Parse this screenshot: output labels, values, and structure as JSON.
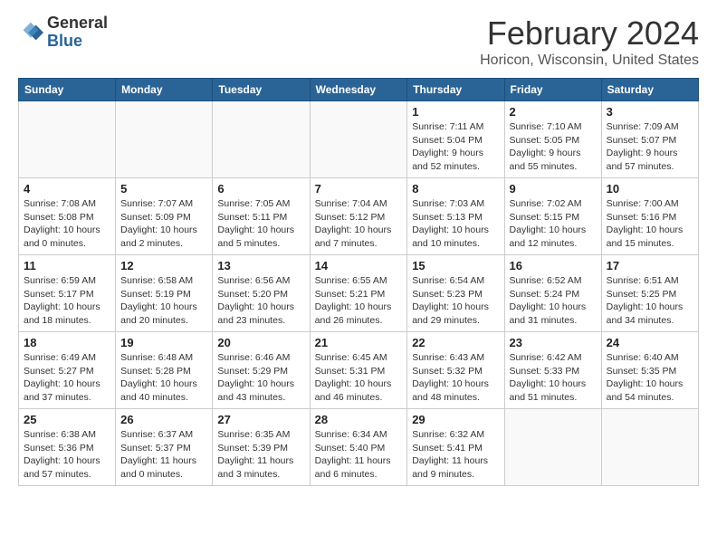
{
  "header": {
    "logo": {
      "general": "General",
      "blue": "Blue"
    },
    "title": "February 2024",
    "location": "Horicon, Wisconsin, United States"
  },
  "days_of_week": [
    "Sunday",
    "Monday",
    "Tuesday",
    "Wednesday",
    "Thursday",
    "Friday",
    "Saturday"
  ],
  "weeks": [
    [
      {
        "day": "",
        "info": ""
      },
      {
        "day": "",
        "info": ""
      },
      {
        "day": "",
        "info": ""
      },
      {
        "day": "",
        "info": ""
      },
      {
        "day": "1",
        "info": "Sunrise: 7:11 AM\nSunset: 5:04 PM\nDaylight: 9 hours\nand 52 minutes."
      },
      {
        "day": "2",
        "info": "Sunrise: 7:10 AM\nSunset: 5:05 PM\nDaylight: 9 hours\nand 55 minutes."
      },
      {
        "day": "3",
        "info": "Sunrise: 7:09 AM\nSunset: 5:07 PM\nDaylight: 9 hours\nand 57 minutes."
      }
    ],
    [
      {
        "day": "4",
        "info": "Sunrise: 7:08 AM\nSunset: 5:08 PM\nDaylight: 10 hours\nand 0 minutes."
      },
      {
        "day": "5",
        "info": "Sunrise: 7:07 AM\nSunset: 5:09 PM\nDaylight: 10 hours\nand 2 minutes."
      },
      {
        "day": "6",
        "info": "Sunrise: 7:05 AM\nSunset: 5:11 PM\nDaylight: 10 hours\nand 5 minutes."
      },
      {
        "day": "7",
        "info": "Sunrise: 7:04 AM\nSunset: 5:12 PM\nDaylight: 10 hours\nand 7 minutes."
      },
      {
        "day": "8",
        "info": "Sunrise: 7:03 AM\nSunset: 5:13 PM\nDaylight: 10 hours\nand 10 minutes."
      },
      {
        "day": "9",
        "info": "Sunrise: 7:02 AM\nSunset: 5:15 PM\nDaylight: 10 hours\nand 12 minutes."
      },
      {
        "day": "10",
        "info": "Sunrise: 7:00 AM\nSunset: 5:16 PM\nDaylight: 10 hours\nand 15 minutes."
      }
    ],
    [
      {
        "day": "11",
        "info": "Sunrise: 6:59 AM\nSunset: 5:17 PM\nDaylight: 10 hours\nand 18 minutes."
      },
      {
        "day": "12",
        "info": "Sunrise: 6:58 AM\nSunset: 5:19 PM\nDaylight: 10 hours\nand 20 minutes."
      },
      {
        "day": "13",
        "info": "Sunrise: 6:56 AM\nSunset: 5:20 PM\nDaylight: 10 hours\nand 23 minutes."
      },
      {
        "day": "14",
        "info": "Sunrise: 6:55 AM\nSunset: 5:21 PM\nDaylight: 10 hours\nand 26 minutes."
      },
      {
        "day": "15",
        "info": "Sunrise: 6:54 AM\nSunset: 5:23 PM\nDaylight: 10 hours\nand 29 minutes."
      },
      {
        "day": "16",
        "info": "Sunrise: 6:52 AM\nSunset: 5:24 PM\nDaylight: 10 hours\nand 31 minutes."
      },
      {
        "day": "17",
        "info": "Sunrise: 6:51 AM\nSunset: 5:25 PM\nDaylight: 10 hours\nand 34 minutes."
      }
    ],
    [
      {
        "day": "18",
        "info": "Sunrise: 6:49 AM\nSunset: 5:27 PM\nDaylight: 10 hours\nand 37 minutes."
      },
      {
        "day": "19",
        "info": "Sunrise: 6:48 AM\nSunset: 5:28 PM\nDaylight: 10 hours\nand 40 minutes."
      },
      {
        "day": "20",
        "info": "Sunrise: 6:46 AM\nSunset: 5:29 PM\nDaylight: 10 hours\nand 43 minutes."
      },
      {
        "day": "21",
        "info": "Sunrise: 6:45 AM\nSunset: 5:31 PM\nDaylight: 10 hours\nand 46 minutes."
      },
      {
        "day": "22",
        "info": "Sunrise: 6:43 AM\nSunset: 5:32 PM\nDaylight: 10 hours\nand 48 minutes."
      },
      {
        "day": "23",
        "info": "Sunrise: 6:42 AM\nSunset: 5:33 PM\nDaylight: 10 hours\nand 51 minutes."
      },
      {
        "day": "24",
        "info": "Sunrise: 6:40 AM\nSunset: 5:35 PM\nDaylight: 10 hours\nand 54 minutes."
      }
    ],
    [
      {
        "day": "25",
        "info": "Sunrise: 6:38 AM\nSunset: 5:36 PM\nDaylight: 10 hours\nand 57 minutes."
      },
      {
        "day": "26",
        "info": "Sunrise: 6:37 AM\nSunset: 5:37 PM\nDaylight: 11 hours\nand 0 minutes."
      },
      {
        "day": "27",
        "info": "Sunrise: 6:35 AM\nSunset: 5:39 PM\nDaylight: 11 hours\nand 3 minutes."
      },
      {
        "day": "28",
        "info": "Sunrise: 6:34 AM\nSunset: 5:40 PM\nDaylight: 11 hours\nand 6 minutes."
      },
      {
        "day": "29",
        "info": "Sunrise: 6:32 AM\nSunset: 5:41 PM\nDaylight: 11 hours\nand 9 minutes."
      },
      {
        "day": "",
        "info": ""
      },
      {
        "day": "",
        "info": ""
      }
    ]
  ]
}
